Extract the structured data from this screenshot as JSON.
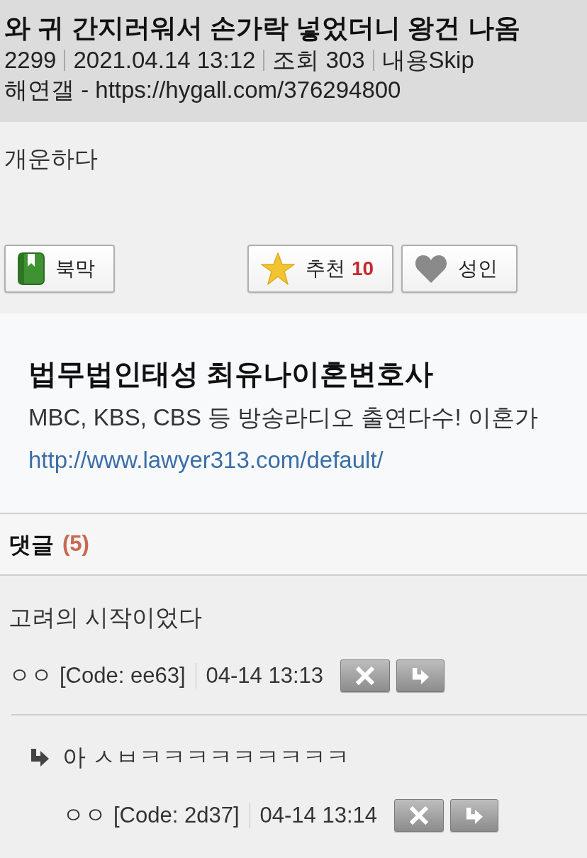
{
  "post": {
    "title": "와 귀 간지러워서 손가락 넣었더니 왕건 나옴",
    "meta": [
      "2299",
      "2021.04.14 13:12",
      "조회 303",
      "내용Skip"
    ],
    "source": "해연갤 - https://hygall.com/376294800"
  },
  "body": {
    "text": "개운하다"
  },
  "actions": [
    {
      "kind": "bookmark",
      "label": "북막"
    },
    {
      "kind": "recommend",
      "label": "추천",
      "count": "10"
    },
    {
      "kind": "adult",
      "label": "성인"
    }
  ],
  "ad": {
    "title": "법무법인태성 최유나이혼변호사",
    "description": "MBC, KBS, CBS 등 방송라디오 출연다수! 이혼가",
    "link": "http://www.lawyer313.com/default/"
  },
  "comments": {
    "heading": "댓글",
    "count": "(5)",
    "items": [
      {
        "text": "고려의 시작이었다",
        "author": "ㅇㅇ",
        "code": "[Code: ee63]",
        "time": "04-14 13:13",
        "children": [
          {
            "text": "아 ㅅㅂㅋㅋㅋㅋㅋㅋㅋㅋㅋ",
            "author": "ㅇㅇ",
            "code": "[Code: 2d37]",
            "time": "04-14 13:14"
          }
        ]
      }
    ]
  }
}
